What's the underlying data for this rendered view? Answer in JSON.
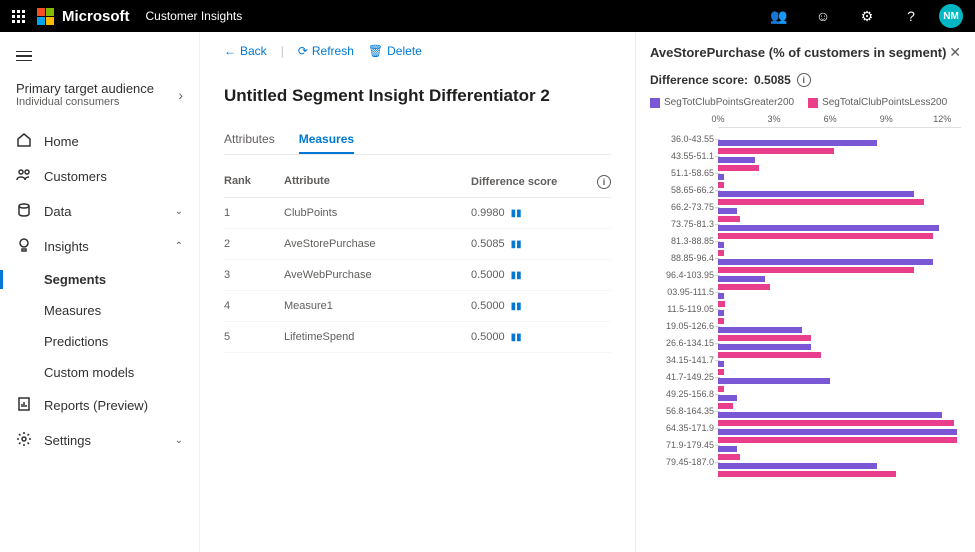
{
  "topbar": {
    "brand": "Microsoft",
    "product": "Customer Insights",
    "avatar": "NM"
  },
  "sidebar": {
    "audience": {
      "title": "Primary target audience",
      "sub": "Individual consumers"
    },
    "items": [
      {
        "label": "Home",
        "icon": "home"
      },
      {
        "label": "Customers",
        "icon": "customers"
      },
      {
        "label": "Data",
        "icon": "data",
        "expand": "down"
      },
      {
        "label": "Insights",
        "icon": "insights",
        "expand": "up"
      },
      {
        "label": "Segments",
        "sub": true,
        "active": true
      },
      {
        "label": "Measures",
        "sub": true
      },
      {
        "label": "Predictions",
        "sub": true
      },
      {
        "label": "Custom models",
        "sub": true
      },
      {
        "label": "Reports (Preview)",
        "icon": "reports"
      },
      {
        "label": "Settings",
        "icon": "settings",
        "expand": "down"
      }
    ]
  },
  "cmdbar": {
    "back": "Back",
    "refresh": "Refresh",
    "delete": "Delete"
  },
  "page": {
    "title": "Untitled Segment Insight Differentiator 2",
    "tabs": {
      "attributes": "Attributes",
      "measures": "Measures"
    },
    "table": {
      "headers": {
        "rank": "Rank",
        "attr": "Attribute",
        "score": "Difference score"
      },
      "rows": [
        {
          "rank": "1",
          "attr": "ClubPoints",
          "score": "0.9980"
        },
        {
          "rank": "2",
          "attr": "AveStorePurchase",
          "score": "0.5085"
        },
        {
          "rank": "3",
          "attr": "AveWebPurchase",
          "score": "0.5000"
        },
        {
          "rank": "4",
          "attr": "Measure1",
          "score": "0.5000"
        },
        {
          "rank": "5",
          "attr": "LifetimeSpend",
          "score": "0.5000"
        }
      ]
    }
  },
  "panel": {
    "title": "AveStorePurchase (% of customers in segment)",
    "diff_label": "Difference score:",
    "diff_value": "0.5085",
    "legend": {
      "a": "SegTotClubPointsGreater200",
      "b": "SegTotalClubPointsLess200"
    },
    "colors": {
      "a": "#7957d5",
      "b": "#e83e8c"
    },
    "ticks": [
      "0%",
      "3%",
      "6%",
      "9%",
      "12%"
    ]
  },
  "chart_data": {
    "type": "bar",
    "xlabel": "% of customers",
    "xlim": [
      0,
      13
    ],
    "categories": [
      "36.0-43.55",
      "43.55-51.1",
      "51.1-58.65",
      "58.65-66.2",
      "66.2-73.75",
      "73.75-81.3",
      "81.3-88.85",
      "88.85-96.4",
      "96.4-103.95",
      "03.95-111.5",
      "11.5-119.05",
      "19.05-126.6",
      "26.6-134.15",
      "34.15-141.7",
      "41.7-149.25",
      "49.25-156.8",
      "56.8-164.35",
      "64.35-171.9",
      "71.9-179.45",
      "79.45-187.0"
    ],
    "series": [
      {
        "name": "SegTotClubPointsGreater200",
        "color": "#7957d5",
        "values": [
          8.5,
          2.0,
          0.3,
          10.5,
          1.0,
          11.8,
          0.3,
          11.5,
          2.5,
          0.3,
          0.3,
          4.5,
          5.0,
          0.3,
          6.0,
          1.0,
          12.0,
          12.8,
          1.0,
          8.5
        ]
      },
      {
        "name": "SegTotalClubPointsLess200",
        "color": "#e83e8c",
        "values": [
          6.2,
          2.2,
          0.3,
          11.0,
          1.2,
          11.5,
          0.3,
          10.5,
          2.8,
          0.4,
          0.3,
          5.0,
          5.5,
          0.3,
          0.3,
          0.8,
          12.6,
          12.8,
          1.2,
          9.5
        ]
      }
    ]
  }
}
